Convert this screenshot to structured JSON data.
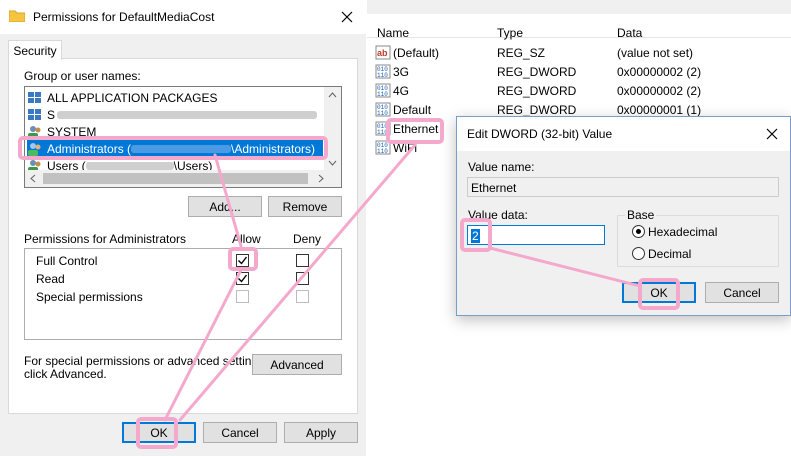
{
  "permissions_dialog": {
    "title": "Permissions for DefaultMediaCost",
    "tab": "Security",
    "group_label": "Group or user names:",
    "users": [
      {
        "name": "ALL APPLICATION PACKAGES",
        "selected": false
      },
      {
        "name": "S",
        "redacted": true,
        "selected": false
      },
      {
        "name": "SYSTEM",
        "selected": false
      },
      {
        "name": "Administrators (",
        "suffix": "\\Administrators)",
        "redacted": true,
        "selected": true
      },
      {
        "name": "Users (",
        "suffix": "\\Users)",
        "redacted": true,
        "selected": false
      }
    ],
    "add_label": "Add...",
    "remove_label": "Remove",
    "permissions_for": "Permissions for Administrators",
    "allow_header": "Allow",
    "deny_header": "Deny",
    "permissions": [
      {
        "name": "Full Control",
        "allow": true,
        "deny": false,
        "disabled": false
      },
      {
        "name": "Read",
        "allow": true,
        "deny": false,
        "disabled": false
      },
      {
        "name": "Special permissions",
        "allow": false,
        "deny": false,
        "disabled": true
      }
    ],
    "advanced_note_line1": "For special permissions or advanced settings,",
    "advanced_note_line2": "click Advanced.",
    "advanced_label": "Advanced",
    "ok_label": "OK",
    "cancel_label": "Cancel",
    "apply_label": "Apply"
  },
  "registry": {
    "columns": [
      "Name",
      "Type",
      "Data"
    ],
    "rows": [
      {
        "name": "(Default)",
        "type": "REG_SZ",
        "data": "(value not set)",
        "icon": "string-value-icon"
      },
      {
        "name": "3G",
        "type": "REG_DWORD",
        "data": "0x00000002 (2)",
        "icon": "dword-value-icon"
      },
      {
        "name": "4G",
        "type": "REG_DWORD",
        "data": "0x00000002 (2)",
        "icon": "dword-value-icon"
      },
      {
        "name": "Default",
        "type": "REG_DWORD",
        "data": "0x00000001 (1)",
        "icon": "dword-value-icon"
      },
      {
        "name": "Ethernet",
        "type": "",
        "data": "",
        "icon": "dword-value-icon"
      },
      {
        "name": "WiFi",
        "type": "",
        "data": "",
        "icon": "dword-value-icon"
      }
    ]
  },
  "dword_dialog": {
    "title": "Edit DWORD (32-bit) Value",
    "value_name_label": "Value name:",
    "value_name": "Ethernet",
    "value_data_label": "Value data:",
    "value_data": "2",
    "base_label": "Base",
    "hex_label": "Hexadecimal",
    "dec_label": "Decimal",
    "selected_base": "Hexadecimal",
    "ok_label": "OK",
    "cancel_label": "Cancel"
  },
  "colors": {
    "highlight": "#f4a9cc",
    "selection": "#0078d7",
    "dialog_bg": "#f0f0f0"
  }
}
